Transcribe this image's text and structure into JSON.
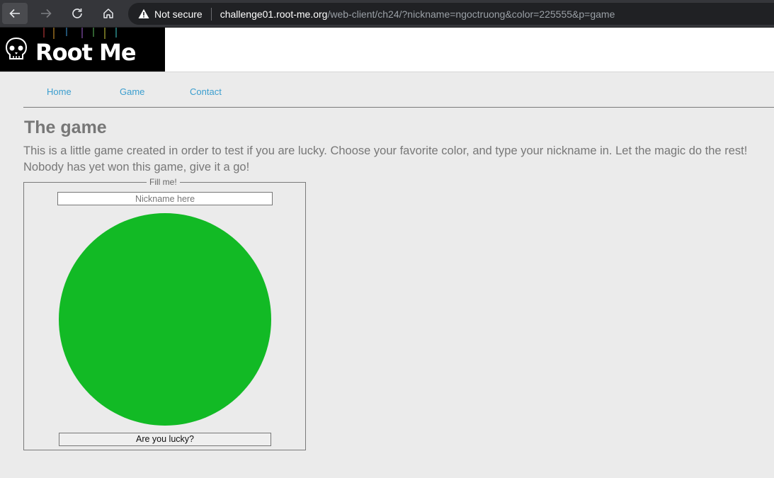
{
  "browser": {
    "security_label": "Not secure",
    "url_host": "challenge01.root-me.org",
    "url_path": "/web-client/ch24/?nickname=ngoctruong&color=225555&p=game"
  },
  "site": {
    "logo_text": "Root Me"
  },
  "nav": {
    "items": [
      {
        "label": "Home"
      },
      {
        "label": "Game"
      },
      {
        "label": "Contact"
      }
    ],
    "link_color": "#3b9ecf"
  },
  "main": {
    "title": "The game",
    "intro_line1": "This is a little game created in order to test if you are lucky. Choose your favorite color, and type your nickname in. Let the magic do the rest!",
    "intro_line2": "Nobody has yet won this game, give it a go!"
  },
  "form": {
    "legend": "Fill me!",
    "nickname_placeholder": "Nickname here",
    "circle_color": "#12ba25",
    "submit_label": "Are you lucky?"
  }
}
